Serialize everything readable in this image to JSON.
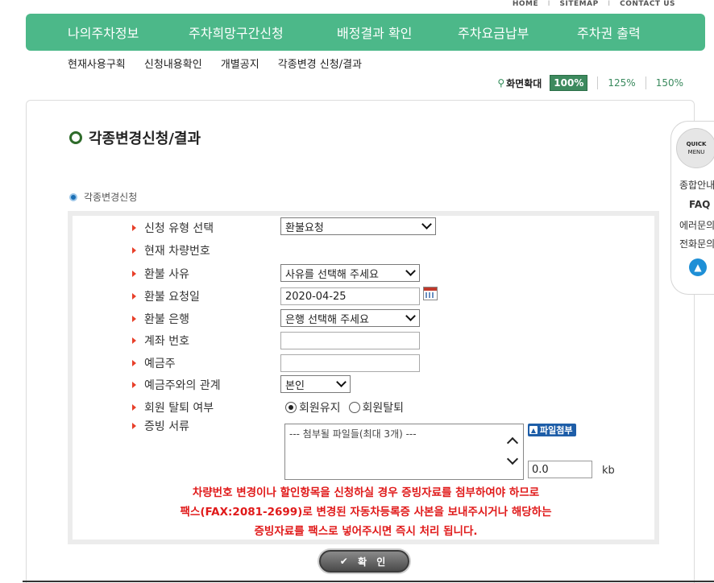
{
  "top_links": {
    "home": "HOME",
    "sitemap": "SITEMAP",
    "contact": "CONTACT US",
    "separator": "I"
  },
  "gnb": [
    {
      "label": "나의주차정보"
    },
    {
      "label": "주차희망구간신청"
    },
    {
      "label": "배정결과 확인"
    },
    {
      "label": "주차요금납부"
    },
    {
      "label": "주차권 출력"
    }
  ],
  "subnav": [
    "현재사용구획",
    "신청내용확인",
    "개별공지",
    "각종변경 신청/결과"
  ],
  "zoom": {
    "label": "화면확대",
    "options": [
      "100%",
      "125%",
      "150%"
    ],
    "selected": "100%"
  },
  "page_title": "각종변경신청/결과",
  "section_title": "각종변경신청",
  "form": {
    "request_type": {
      "label": "신청 유형 선택",
      "value": "환불요청"
    },
    "car_number": {
      "label": "현재 차량번호"
    },
    "refund_reason": {
      "label": "환불 사유",
      "value": "사유를 선택해 주세요"
    },
    "refund_date": {
      "label": "환불 요청일",
      "value": "2020-04-25"
    },
    "refund_bank": {
      "label": "환불 은행",
      "value": "은행 선택해 주세요"
    },
    "account_number": {
      "label": "계좌 번호",
      "value": ""
    },
    "depositor": {
      "label": "예금주",
      "value": ""
    },
    "relation": {
      "label": "예금주와의 관계",
      "value": "본인"
    },
    "membership": {
      "label": "회원 탈퇴 여부",
      "options": [
        "회원유지",
        "회원탈퇴"
      ],
      "selected": "회원유지"
    },
    "documents": {
      "label": "증빙 서류",
      "placeholder": "--- 첨부될 파일들(최대 3개) ---",
      "attach_label": "파일첨부",
      "size_value": "0.0",
      "size_unit": "kb"
    }
  },
  "notice": [
    "차량번호 변경이나 할인항목을 신청하실 경우 증빙자료를 첨부하여야 하므로",
    "팩스(FAX:2081-2699)로 변경된 자동차등록증 사본을 보내주시거나 해당하는",
    "증빙자료를 팩스로 넣어주시면 즉시 처리 됩니다."
  ],
  "confirm_label": "확 인",
  "quick_menu": {
    "title_top": "QUICK",
    "title_bottom": "MENU",
    "items": [
      "종합안내",
      "FAQ",
      "에러문의",
      "전화문의"
    ]
  },
  "colors": {
    "gnb": "#4cb889",
    "notice": "#e01a1a",
    "zoom_selected": "#3d8a5e"
  }
}
